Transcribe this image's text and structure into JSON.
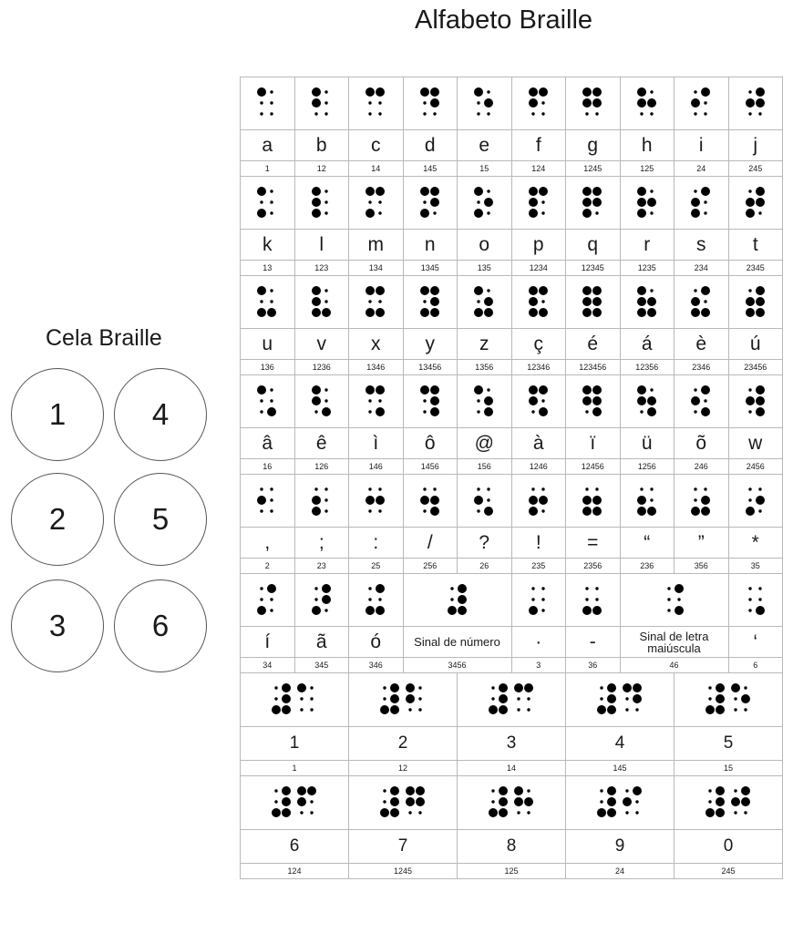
{
  "title": "Alfabeto Braille",
  "cela": {
    "title": "Cela Braille",
    "circles": [
      "1",
      "2",
      "3",
      "4",
      "5",
      "6"
    ]
  },
  "letter_rows": [
    [
      {
        "ch": "a",
        "code": "1"
      },
      {
        "ch": "b",
        "code": "12"
      },
      {
        "ch": "c",
        "code": "14"
      },
      {
        "ch": "d",
        "code": "145"
      },
      {
        "ch": "e",
        "code": "15"
      },
      {
        "ch": "f",
        "code": "124"
      },
      {
        "ch": "g",
        "code": "1245"
      },
      {
        "ch": "h",
        "code": "125"
      },
      {
        "ch": "i",
        "code": "24"
      },
      {
        "ch": "j",
        "code": "245"
      }
    ],
    [
      {
        "ch": "k",
        "code": "13"
      },
      {
        "ch": "l",
        "code": "123"
      },
      {
        "ch": "m",
        "code": "134"
      },
      {
        "ch": "n",
        "code": "1345"
      },
      {
        "ch": "o",
        "code": "135"
      },
      {
        "ch": "p",
        "code": "1234"
      },
      {
        "ch": "q",
        "code": "12345"
      },
      {
        "ch": "r",
        "code": "1235"
      },
      {
        "ch": "s",
        "code": "234"
      },
      {
        "ch": "t",
        "code": "2345"
      }
    ],
    [
      {
        "ch": "u",
        "code": "136"
      },
      {
        "ch": "v",
        "code": "1236"
      },
      {
        "ch": "x",
        "code": "1346"
      },
      {
        "ch": "y",
        "code": "13456"
      },
      {
        "ch": "z",
        "code": "1356"
      },
      {
        "ch": "ç",
        "code": "12346"
      },
      {
        "ch": "é",
        "code": "123456"
      },
      {
        "ch": "á",
        "code": "12356"
      },
      {
        "ch": "è",
        "code": "2346"
      },
      {
        "ch": "ú",
        "code": "23456"
      }
    ],
    [
      {
        "ch": "â",
        "code": "16"
      },
      {
        "ch": "ê",
        "code": "126"
      },
      {
        "ch": "ì",
        "code": "146"
      },
      {
        "ch": "ô",
        "code": "1456"
      },
      {
        "ch": "@",
        "code": "156"
      },
      {
        "ch": "à",
        "code": "1246"
      },
      {
        "ch": "ï",
        "code": "12456"
      },
      {
        "ch": "ü",
        "code": "1256"
      },
      {
        "ch": "õ",
        "code": "246"
      },
      {
        "ch": "w",
        "code": "2456"
      }
    ],
    [
      {
        "ch": ",",
        "code": "2"
      },
      {
        "ch": ";",
        "code": "23"
      },
      {
        "ch": ":",
        "code": "25"
      },
      {
        "ch": "/",
        "code": "256"
      },
      {
        "ch": "?",
        "code": "26"
      },
      {
        "ch": "!",
        "code": "235"
      },
      {
        "ch": "=",
        "code": "2356"
      },
      {
        "ch": "“",
        "code": "236"
      },
      {
        "ch": "”",
        "code": "356"
      },
      {
        "ch": "*",
        "code": "35"
      }
    ],
    [
      {
        "ch": "í",
        "code": "34"
      },
      {
        "ch": "ã",
        "code": "345"
      },
      {
        "ch": "ó",
        "code": "346"
      },
      {
        "ch": "Sinal de número",
        "code": "3456",
        "span": 2
      },
      {
        "ch": "·",
        "code": "3"
      },
      {
        "ch": "-",
        "code": "36"
      },
      {
        "ch": "Sinal de letra maiúscula",
        "code": "46",
        "span": 2
      },
      {
        "ch": "‘",
        "code": "6"
      }
    ]
  ],
  "number_rows": [
    [
      {
        "ch": "1",
        "code": "1"
      },
      {
        "ch": "2",
        "code": "12"
      },
      {
        "ch": "3",
        "code": "14"
      },
      {
        "ch": "4",
        "code": "145"
      },
      {
        "ch": "5",
        "code": "15"
      }
    ],
    [
      {
        "ch": "6",
        "code": "124"
      },
      {
        "ch": "7",
        "code": "1245"
      },
      {
        "ch": "8",
        "code": "125"
      },
      {
        "ch": "9",
        "code": "24"
      },
      {
        "ch": "0",
        "code": "245"
      }
    ]
  ],
  "number_prefix_code": "3456",
  "colors": {
    "dot": "#000000",
    "grid": "#b9b9b9",
    "circle": "#555555"
  }
}
